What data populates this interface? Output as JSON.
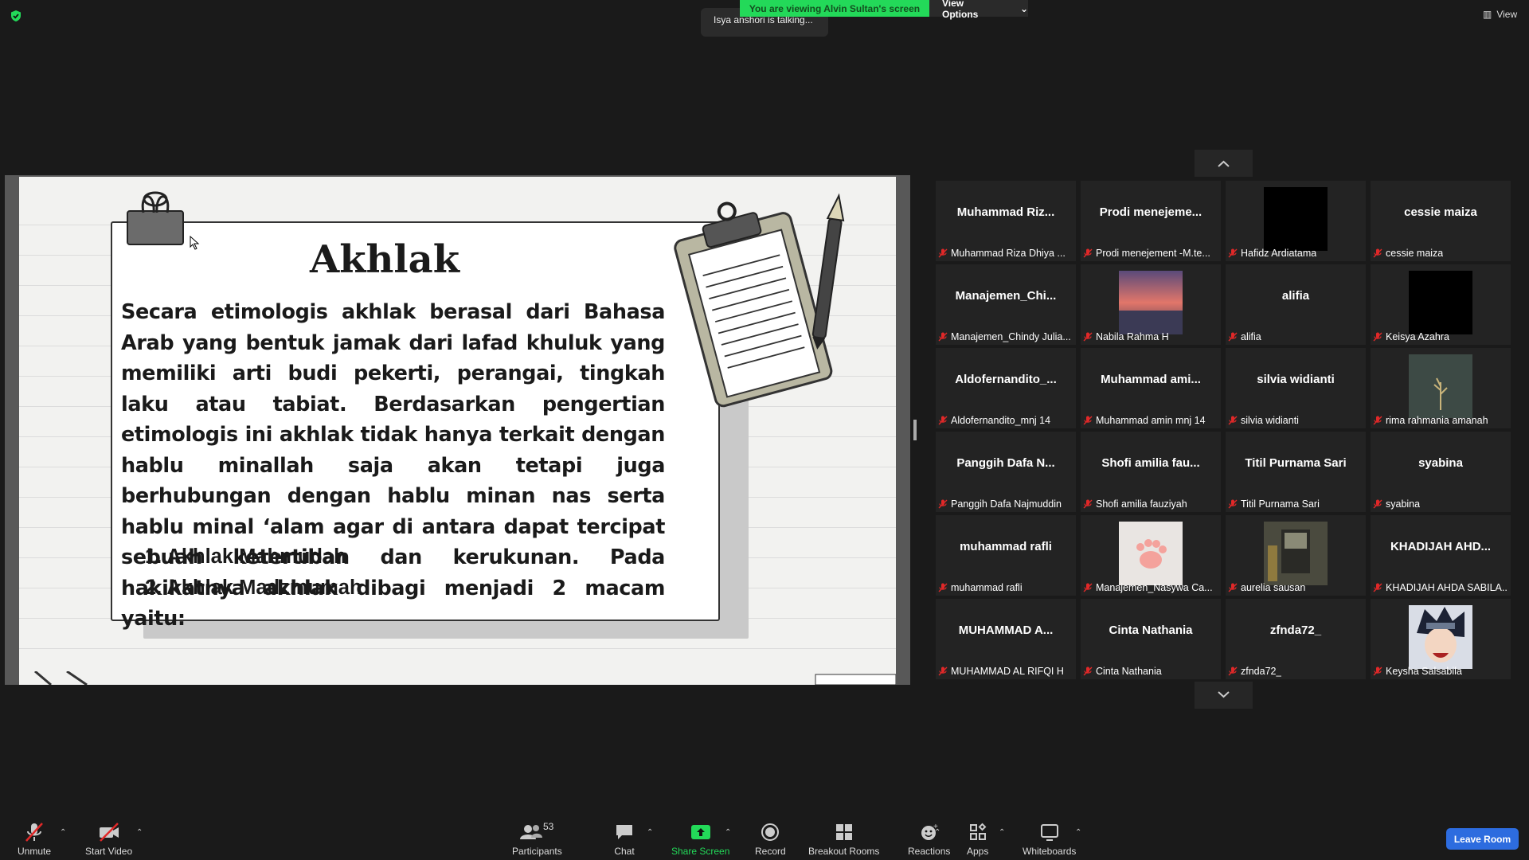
{
  "banner": {
    "viewing": "You are viewing Alvin Sultan's screen",
    "view_options": "View Options",
    "talking": "Isya anshori is talking...",
    "view": "View"
  },
  "slide": {
    "title": "Akhlak",
    "body": "Secara etimologis akhlak berasal dari Bahasa Arab yang bentuk jamak dari lafad khuluk yang memiliki arti budi pekerti, perangai, tingkah laku atau tabiat. Berdasarkan pengertian etimologis ini akhlak tidak hanya terkait dengan hablu minallah saja akan tetapi juga berhubungan dengan hablu minan nas serta hablu minal ‘alam agar di antara dapat tercipat sebuah ketertiban dan kerukunan. Pada hakikatnya akhlak dibagi menjadi 2 macam yaitu:",
    "items": [
      "1. Akhlak Mahmudah",
      "2. Akhlak Madzmumah"
    ]
  },
  "participants": [
    {
      "name": "Muhammad Riz...",
      "label": "Muhammad Riza Dhiya ...",
      "image": null
    },
    {
      "name": "Prodi menejeme...",
      "label": "Prodi menejement -M.te...",
      "image": null
    },
    {
      "name": "",
      "label": "Hafidz Ardiatama",
      "image": "black"
    },
    {
      "name": "cessie maiza",
      "label": "cessie maiza",
      "image": null
    },
    {
      "name": "Manajemen_Chi...",
      "label": "Manajemen_Chindy Julia...",
      "image": null
    },
    {
      "name": "",
      "label": "Nabila Rahma H",
      "image": "sunset"
    },
    {
      "name": "alifia",
      "label": "alifia",
      "image": null
    },
    {
      "name": "",
      "label": "Keisya Azahra",
      "image": "black"
    },
    {
      "name": "Aldofernandito_...",
      "label": "Aldofernandito_mnj 14",
      "image": null
    },
    {
      "name": "Muhammad ami...",
      "label": "Muhammad amin mnj 14",
      "image": null
    },
    {
      "name": "silvia widianti",
      "label": "silvia widianti",
      "image": null
    },
    {
      "name": "",
      "label": "rima rahmania amanah",
      "image": "plant"
    },
    {
      "name": "Panggih Dafa N...",
      "label": "Panggih Dafa Najmuddin",
      "image": null
    },
    {
      "name": "Shofi amilia fau...",
      "label": "Shofi amilia fauziyah",
      "image": null
    },
    {
      "name": "Titil Purnama Sari",
      "label": "Titil Purnama Sari",
      "image": null
    },
    {
      "name": "syabina",
      "label": "syabina",
      "image": null
    },
    {
      "name": "muhammad rafli",
      "label": "muhammad rafli",
      "image": null
    },
    {
      "name": "",
      "label": "Manajemen_Nasywa Ca...",
      "image": "paw"
    },
    {
      "name": "",
      "label": "aurelia sausan",
      "image": "window"
    },
    {
      "name": "KHADIJAH AHD...",
      "label": "KHADIJAH AHDA SABILA...",
      "image": null
    },
    {
      "name": "MUHAMMAD A...",
      "label": "MUHAMMAD AL RIFQI H",
      "image": null
    },
    {
      "name": "Cinta Nathania",
      "label": "Cinta Nathania",
      "image": null
    },
    {
      "name": "zfnda72_",
      "label": "zfnda72_",
      "image": null
    },
    {
      "name": "",
      "label": "Keysha Salsabila",
      "image": "anime"
    }
  ],
  "toolbar": {
    "unmute": "Unmute",
    "start_video": "Start Video",
    "participants": "Participants",
    "participants_count": "53",
    "chat": "Chat",
    "share_screen": "Share Screen",
    "record": "Record",
    "breakout_rooms": "Breakout Rooms",
    "reactions": "Reactions",
    "apps": "Apps",
    "whiteboards": "Whiteboards",
    "leave": "Leave Room"
  },
  "colors": {
    "share_green": "#23d959",
    "leave_blue": "#2d6cdf",
    "muted_red": "#e02828"
  }
}
